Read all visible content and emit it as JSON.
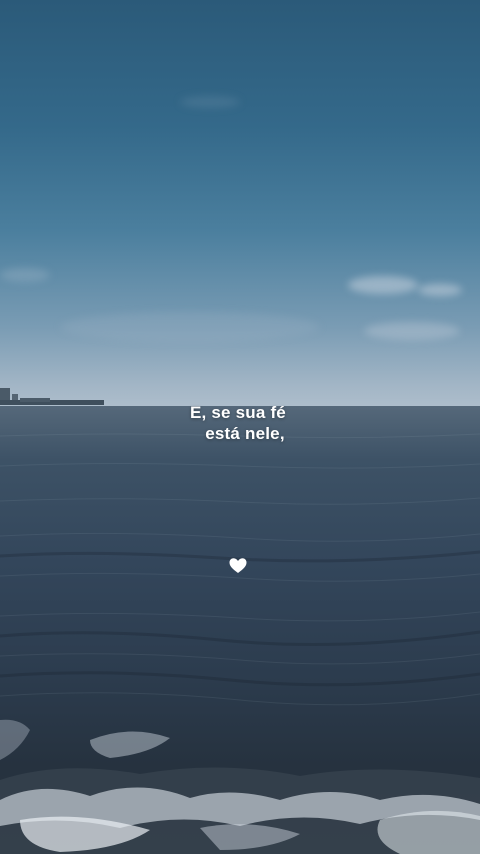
{
  "scene": {
    "description_icon": "heart-icon",
    "colors": {
      "sky_top": "#2b5a79",
      "horizon": "#b4c2cf",
      "sea": "#33465b",
      "text": "#ffffff"
    }
  },
  "caption": {
    "line_1": "E, se sua fé",
    "line_2": "está nele,"
  }
}
